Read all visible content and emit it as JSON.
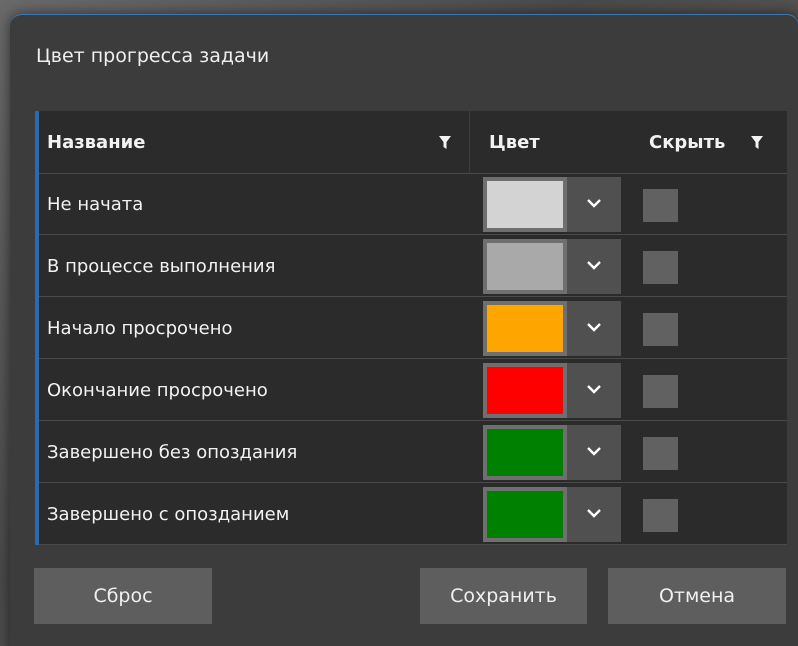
{
  "dialog": {
    "title": "Цвет прогресса задачи"
  },
  "grid": {
    "columns": {
      "name": "Название",
      "color": "Цвет",
      "hide": "Скрыть"
    },
    "rows": [
      {
        "name": "Не начата",
        "color": "#d3d3d3",
        "hidden": false
      },
      {
        "name": "В процессе выполнения",
        "color": "#a9a9a9",
        "hidden": false
      },
      {
        "name": "Начало просрочено",
        "color": "#ffa500",
        "hidden": false
      },
      {
        "name": "Окончание просрочено",
        "color": "#ff0000",
        "hidden": false
      },
      {
        "name": "Завершено без опоздания",
        "color": "#008000",
        "hidden": false
      },
      {
        "name": "Завершено с опозданием",
        "color": "#008000",
        "hidden": false
      }
    ]
  },
  "buttons": {
    "reset": "Сброс",
    "save": "Сохранить",
    "cancel": "Отмена"
  },
  "icons": {
    "filter": "filter-icon",
    "dropdown": "chevron-down-icon"
  },
  "accent_color": "#2a6bb0"
}
